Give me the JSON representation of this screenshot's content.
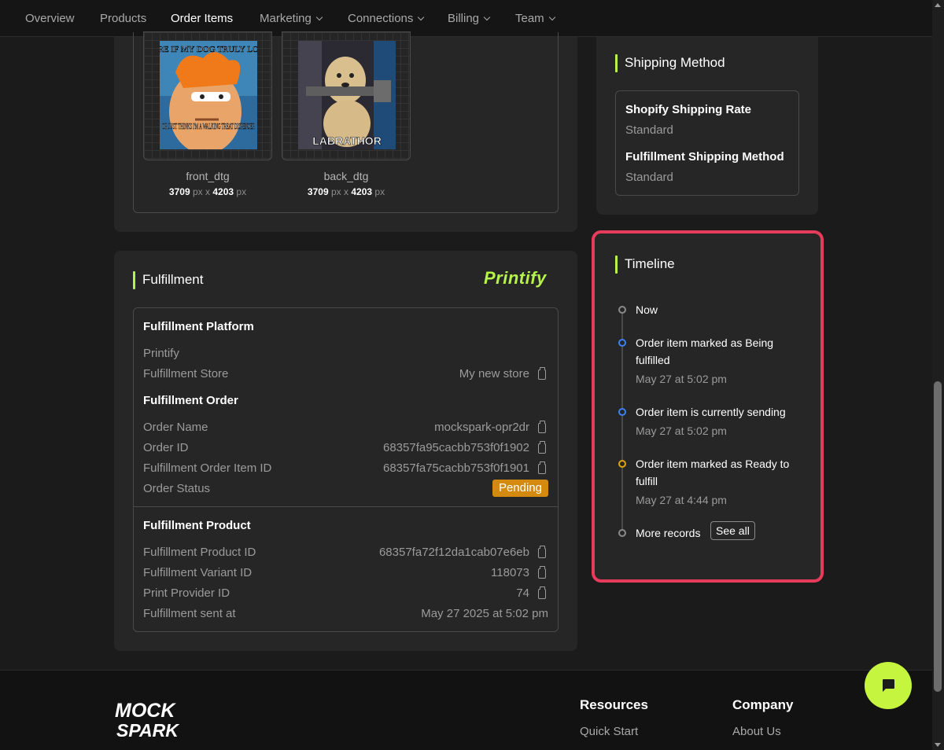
{
  "nav": {
    "items": [
      {
        "label": "Overview",
        "dropdown": false,
        "active": false
      },
      {
        "label": "Products",
        "dropdown": false,
        "active": false
      },
      {
        "label": "Order Items",
        "dropdown": false,
        "active": true
      },
      {
        "label": "Marketing",
        "dropdown": true,
        "active": false
      },
      {
        "label": "Connections",
        "dropdown": true,
        "active": false
      },
      {
        "label": "Billing",
        "dropdown": true,
        "active": false
      },
      {
        "label": "Team",
        "dropdown": true,
        "active": false
      }
    ]
  },
  "design_files": [
    {
      "name": "front_dtg",
      "width": "3709",
      "height": "4203",
      "unit": "px",
      "times": "x",
      "meme_top": "NOT SURE IF MY DOG TRULY LOVES ME",
      "meme_bottom": "OR JUST THINKS I'M A WALKING TREAT DISPENSER"
    },
    {
      "name": "back_dtg",
      "width": "3709",
      "height": "4203",
      "unit": "px",
      "times": "x",
      "meme_bottom": "LABRATHOR"
    }
  ],
  "shipping": {
    "title": "Shipping Method",
    "shopify_rate_label": "Shopify Shipping Rate",
    "shopify_rate_value": "Standard",
    "fulfillment_method_label": "Fulfillment Shipping Method",
    "fulfillment_method_value": "Standard"
  },
  "fulfillment": {
    "title": "Fulfillment",
    "logo_text": "Printify",
    "platform_heading": "Fulfillment Platform",
    "platform_name": "Printify",
    "store_label": "Fulfillment Store",
    "store_value": "My new store",
    "order_heading": "Fulfillment Order",
    "order_name_label": "Order Name",
    "order_name_value": "mockspark-opr2dr",
    "order_id_label": "Order ID",
    "order_id_value": "68357fa95cacbb753f0f1902",
    "order_item_id_label": "Fulfillment Order Item ID",
    "order_item_id_value": "68357fa75cacbb753f0f1901",
    "order_status_label": "Order Status",
    "order_status_value": "Pending",
    "product_heading": "Fulfillment Product",
    "product_id_label": "Fulfillment Product ID",
    "product_id_value": "68357fa72f12da1cab07e6eb",
    "variant_id_label": "Fulfillment Variant ID",
    "variant_id_value": "118073",
    "provider_id_label": "Print Provider ID",
    "provider_id_value": "74",
    "sent_at_label": "Fulfillment sent at",
    "sent_at_value": "May 27 2025 at 5:02 pm"
  },
  "timeline": {
    "title": "Timeline",
    "now_label": "Now",
    "events": [
      {
        "text": "Order item marked as Being fulfilled",
        "time": "May 27 at 5:02 pm",
        "color": "#3b82f6"
      },
      {
        "text": "Order item is currently sending",
        "time": "May 27 at 5:02 pm",
        "color": "#3b82f6"
      },
      {
        "text": "Order item marked as Ready to fulfill",
        "time": "May 27 at 4:44 pm",
        "color": "#e0a310"
      }
    ],
    "more_label": "More records",
    "see_all_label": "See all"
  },
  "footer": {
    "logo_line1": "MOCK",
    "logo_line2": "SPARK",
    "resources_heading": "Resources",
    "resources_link": "Quick Start",
    "company_heading": "Company",
    "company_link": "About Us"
  },
  "colors": {
    "accent": "#b6f34a",
    "highlight_border": "#e63b5a",
    "pending_badge": "#d48a0e",
    "chat_button": "#c6f53f"
  },
  "icons": [
    "chevron-down-icon",
    "copy-icon",
    "chat-icon"
  ]
}
